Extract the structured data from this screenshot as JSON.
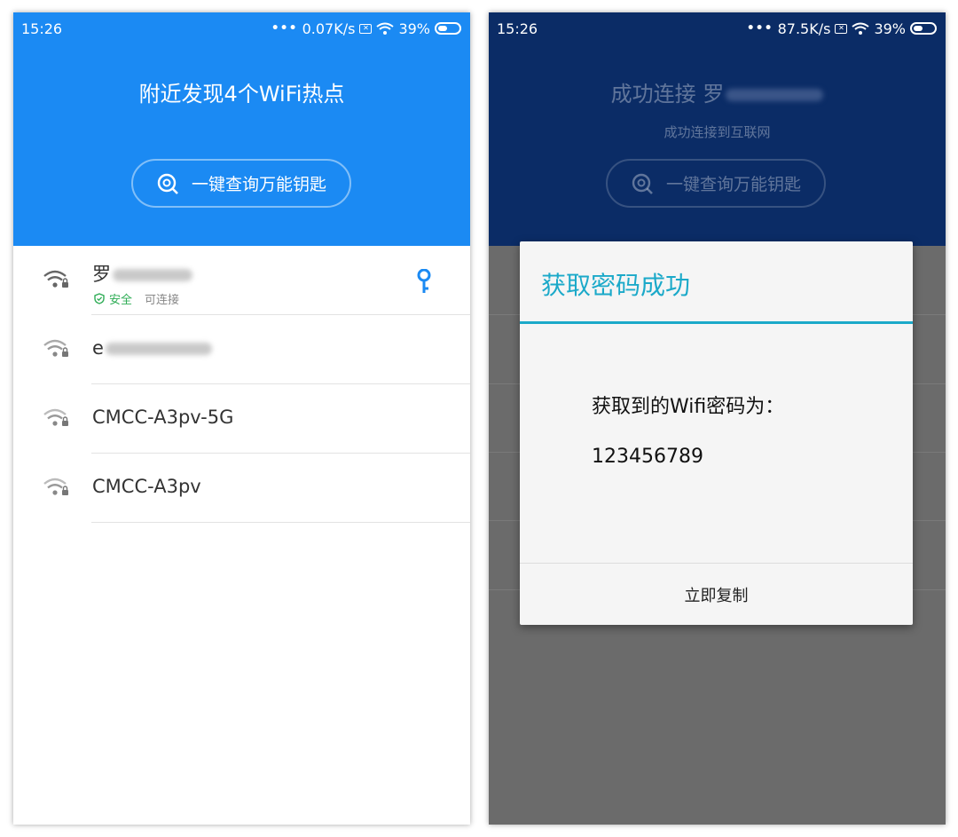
{
  "left": {
    "status": {
      "time": "15:26",
      "speed": "0.07K/s",
      "battery": "39%"
    },
    "header_title": "附近发现4个WiFi热点",
    "query_button": "一键查询万能钥匙",
    "networks": [
      {
        "ssid": "罗",
        "tag_safe": "安全",
        "tag_connect": "可连接",
        "has_key": true,
        "icon": "wifi-lock-icon"
      },
      {
        "ssid": "e",
        "icon": "wifi-lock-icon"
      },
      {
        "ssid": "CMCC-A3pv-5G",
        "icon": "wifi-lock-icon"
      },
      {
        "ssid": "CMCC-A3pv",
        "icon": "wifi-lock-icon"
      }
    ]
  },
  "right": {
    "status": {
      "time": "15:26",
      "speed": "87.5K/s",
      "battery": "39%"
    },
    "header_title": "成功连接 罗",
    "header_subtitle": "成功连接到互联网",
    "query_button": "一键查询万能钥匙",
    "dialog": {
      "title": "获取密码成功",
      "label": "获取到的Wifi密码为：",
      "password": "123456789",
      "copy_button": "立即复制"
    }
  },
  "colors": {
    "primary_blue": "#1b8af3",
    "dark_header": "#0b2c66",
    "dialog_accent": "#1ba9c9",
    "safe_green": "#2eac55"
  }
}
